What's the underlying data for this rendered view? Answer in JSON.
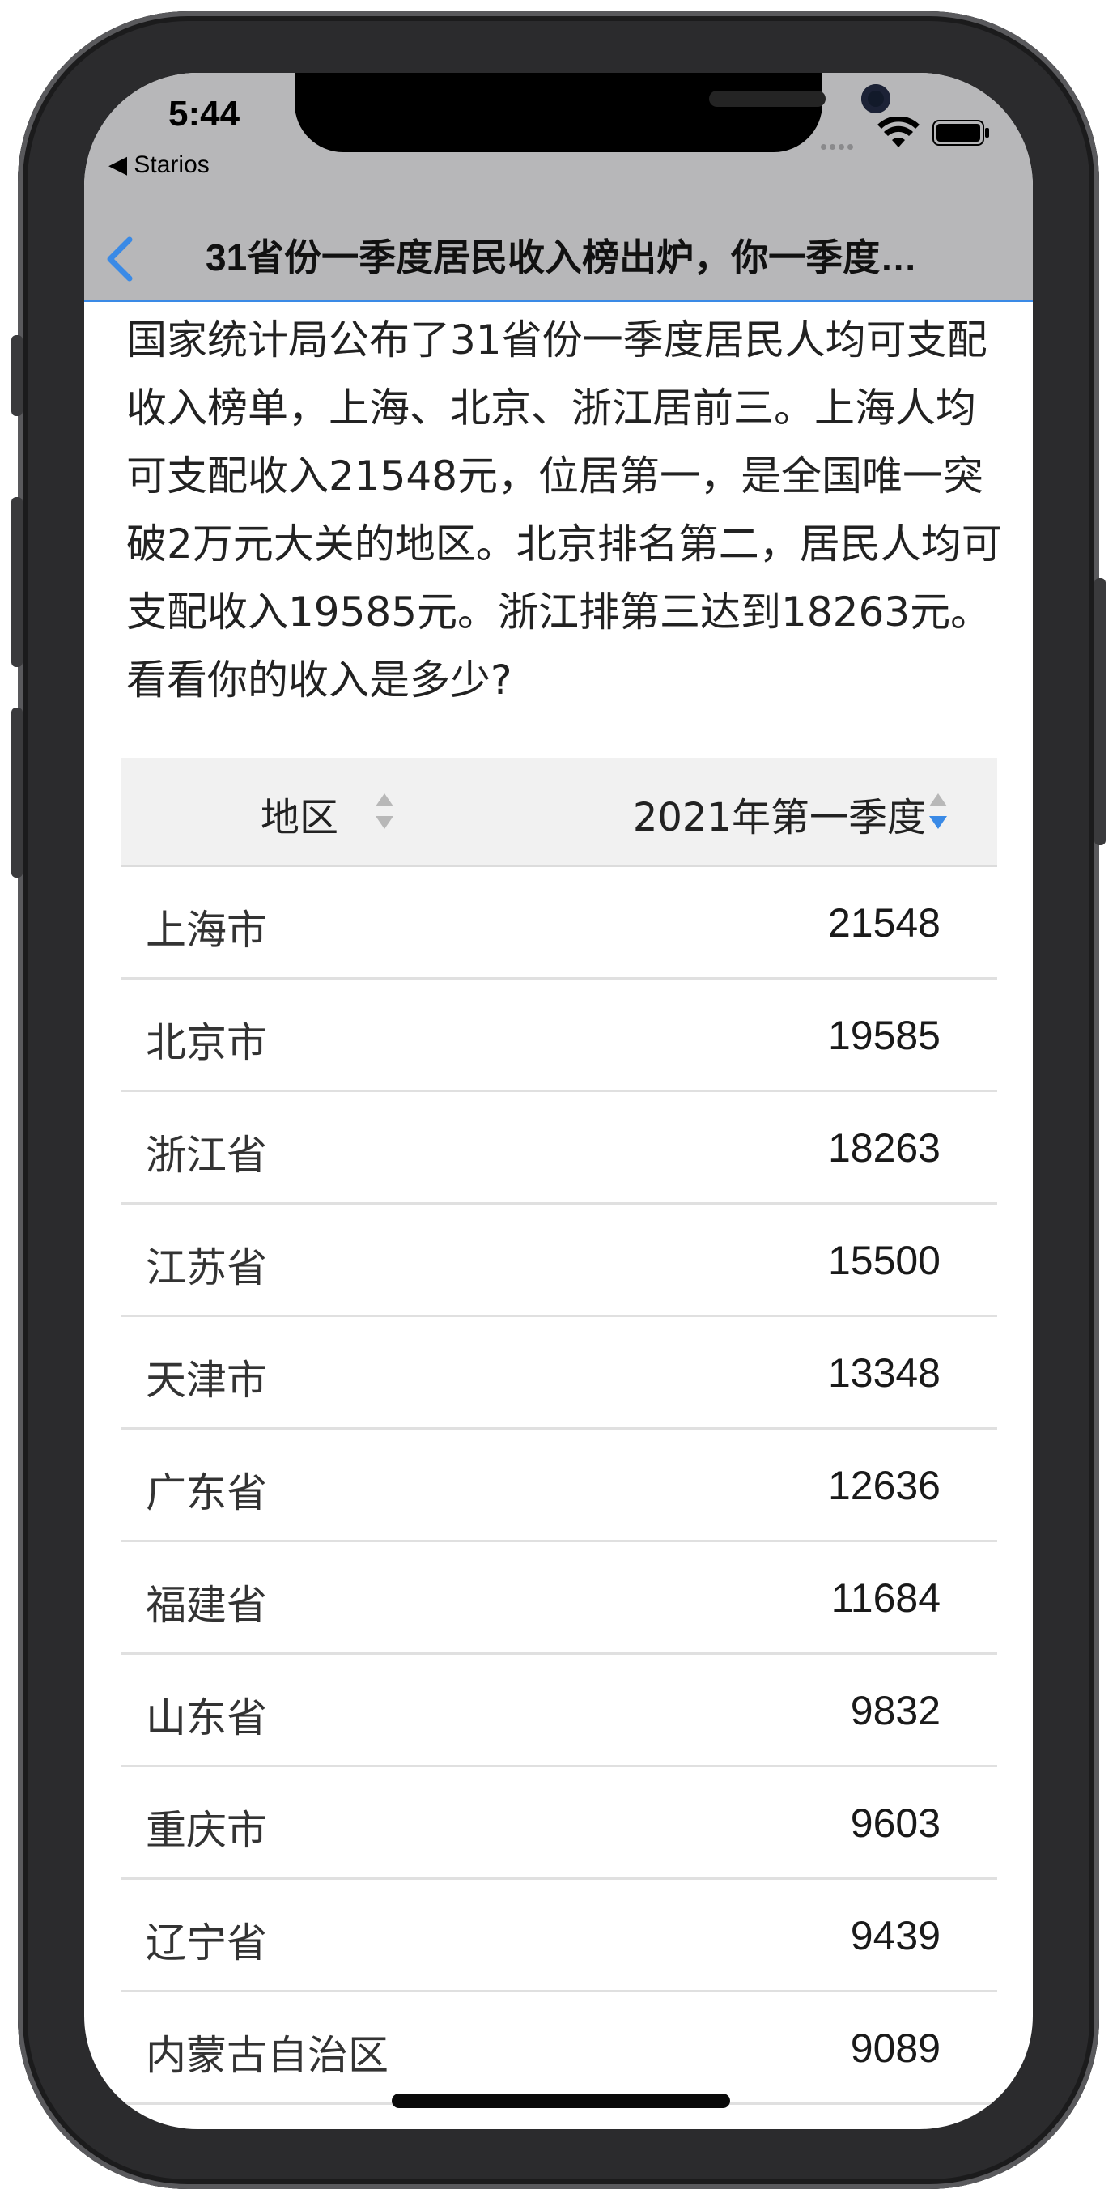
{
  "status": {
    "time": "5:44",
    "back_app": "◀ Starios"
  },
  "nav": {
    "title": "31省份一季度居民收入榜出炉，你一季度…"
  },
  "intro": "国家统计局公布了31省份一季度居民人均可支配收入榜单，上海、北京、浙江居前三。上海人均可支配收入21548元，位居第一，是全国唯一突破2万元大关的地区。北京排名第二，居民人均可支配收入19585元。浙江排第三达到18263元。看看你的收入是多少?",
  "table": {
    "headers": [
      "地区",
      "2021年第一季度"
    ],
    "rows": [
      {
        "region": "上海市",
        "value": "21548"
      },
      {
        "region": "北京市",
        "value": "19585"
      },
      {
        "region": "浙江省",
        "value": "18263"
      },
      {
        "region": "江苏省",
        "value": "15500"
      },
      {
        "region": "天津市",
        "value": "13348"
      },
      {
        "region": "广东省",
        "value": "12636"
      },
      {
        "region": "福建省",
        "value": "11684"
      },
      {
        "region": "山东省",
        "value": "9832"
      },
      {
        "region": "重庆市",
        "value": "9603"
      },
      {
        "region": "辽宁省",
        "value": "9439"
      },
      {
        "region": "内蒙古自治区",
        "value": "9089"
      }
    ]
  },
  "colors": {
    "accent": "#3a8ae6",
    "bar_bg": "#b7b7b9"
  },
  "icons": [
    "back-chevron-icon",
    "wifi-icon",
    "battery-icon",
    "sort-icon",
    "sort-active-icon"
  ]
}
